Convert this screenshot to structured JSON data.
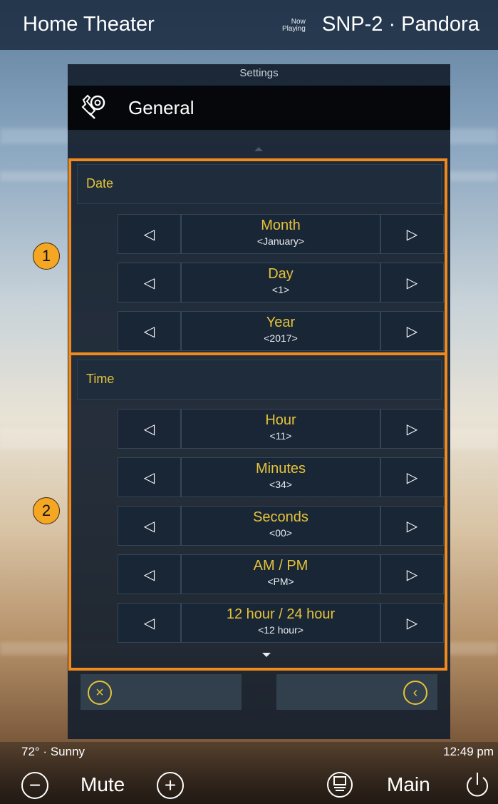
{
  "header": {
    "title": "Home Theater",
    "now_playing_line1": "Now",
    "now_playing_line2": "Playing",
    "source": "SNP-2 · Pandora"
  },
  "panel": {
    "title": "Settings",
    "section": "General",
    "date": {
      "heading": "Date",
      "rows": [
        {
          "label": "Month",
          "value": "<January>"
        },
        {
          "label": "Day",
          "value": "<1>"
        },
        {
          "label": "Year",
          "value": "<2017>"
        }
      ]
    },
    "time": {
      "heading": "Time",
      "rows": [
        {
          "label": "Hour",
          "value": "<11>"
        },
        {
          "label": "Minutes",
          "value": "<34>"
        },
        {
          "label": "Seconds",
          "value": "<00>"
        },
        {
          "label": "AM / PM",
          "value": "<PM>"
        },
        {
          "label": "12 hour / 24 hour",
          "value": "<12 hour>"
        }
      ]
    },
    "arrow_left": "◁",
    "arrow_right": "▷",
    "cancel_icon": "×",
    "back_icon": "‹"
  },
  "annotations": {
    "badge1": "1",
    "badge2": "2"
  },
  "footer": {
    "weather": "72° · Sunny",
    "time": "12:49 pm",
    "mute_label": "Mute",
    "minus_icon": "−",
    "plus_icon": "+",
    "main_label": "Main"
  },
  "icons": [
    "gear-wrench-icon",
    "arrow-left-icon",
    "arrow-right-icon",
    "cancel-icon",
    "back-icon",
    "volume-down-icon",
    "volume-up-icon",
    "remote-icon",
    "power-icon"
  ],
  "colors": {
    "accent": "#e5c33a",
    "highlight": "#f08a1c",
    "badge": "#f5a623"
  }
}
